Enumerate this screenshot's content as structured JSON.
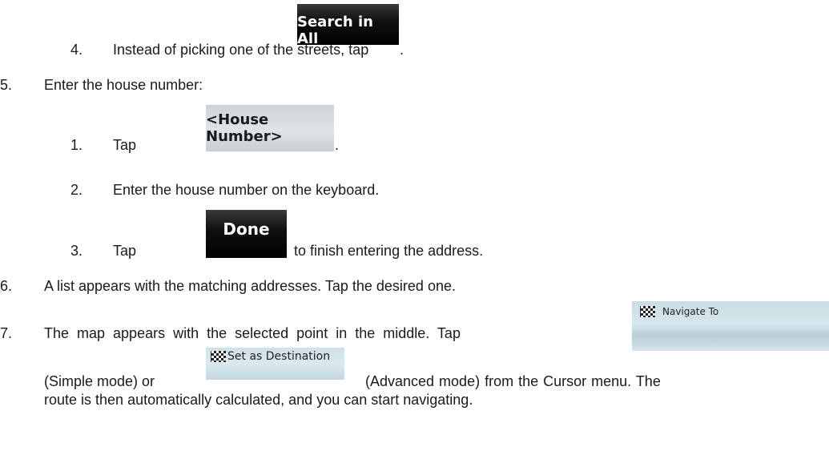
{
  "steps": {
    "s4": {
      "number": "4.",
      "text": "Instead of picking one of the streets, tap",
      "button": "Search in All",
      "after": "."
    },
    "s5": {
      "number": "5.",
      "text": "Enter the house number:"
    },
    "s5_1": {
      "number": "1.",
      "text": "Tap",
      "button": "<House Number>",
      "after": "."
    },
    "s5_2": {
      "number": "2.",
      "text": "Enter the house number on the keyboard."
    },
    "s5_3": {
      "number": "3.",
      "text": "Tap",
      "button": "Done",
      "after": "to finish entering the address."
    },
    "s6": {
      "number": "6.",
      "text": "A list appears with the matching addresses. Tap the desired one."
    },
    "s7": {
      "number": "7.",
      "text": "The map appears with the selected point in the middle. Tap",
      "button_nav": "Navigate To",
      "line2_pre": "(Simple mode) or",
      "button_dest": "Set as Destination",
      "line2_post": "(Advanced mode) from the Cursor menu. The",
      "line3": "route is then automatically calculated, and you can start navigating."
    }
  },
  "icons": {
    "flag": "checkered-flag-icon"
  }
}
